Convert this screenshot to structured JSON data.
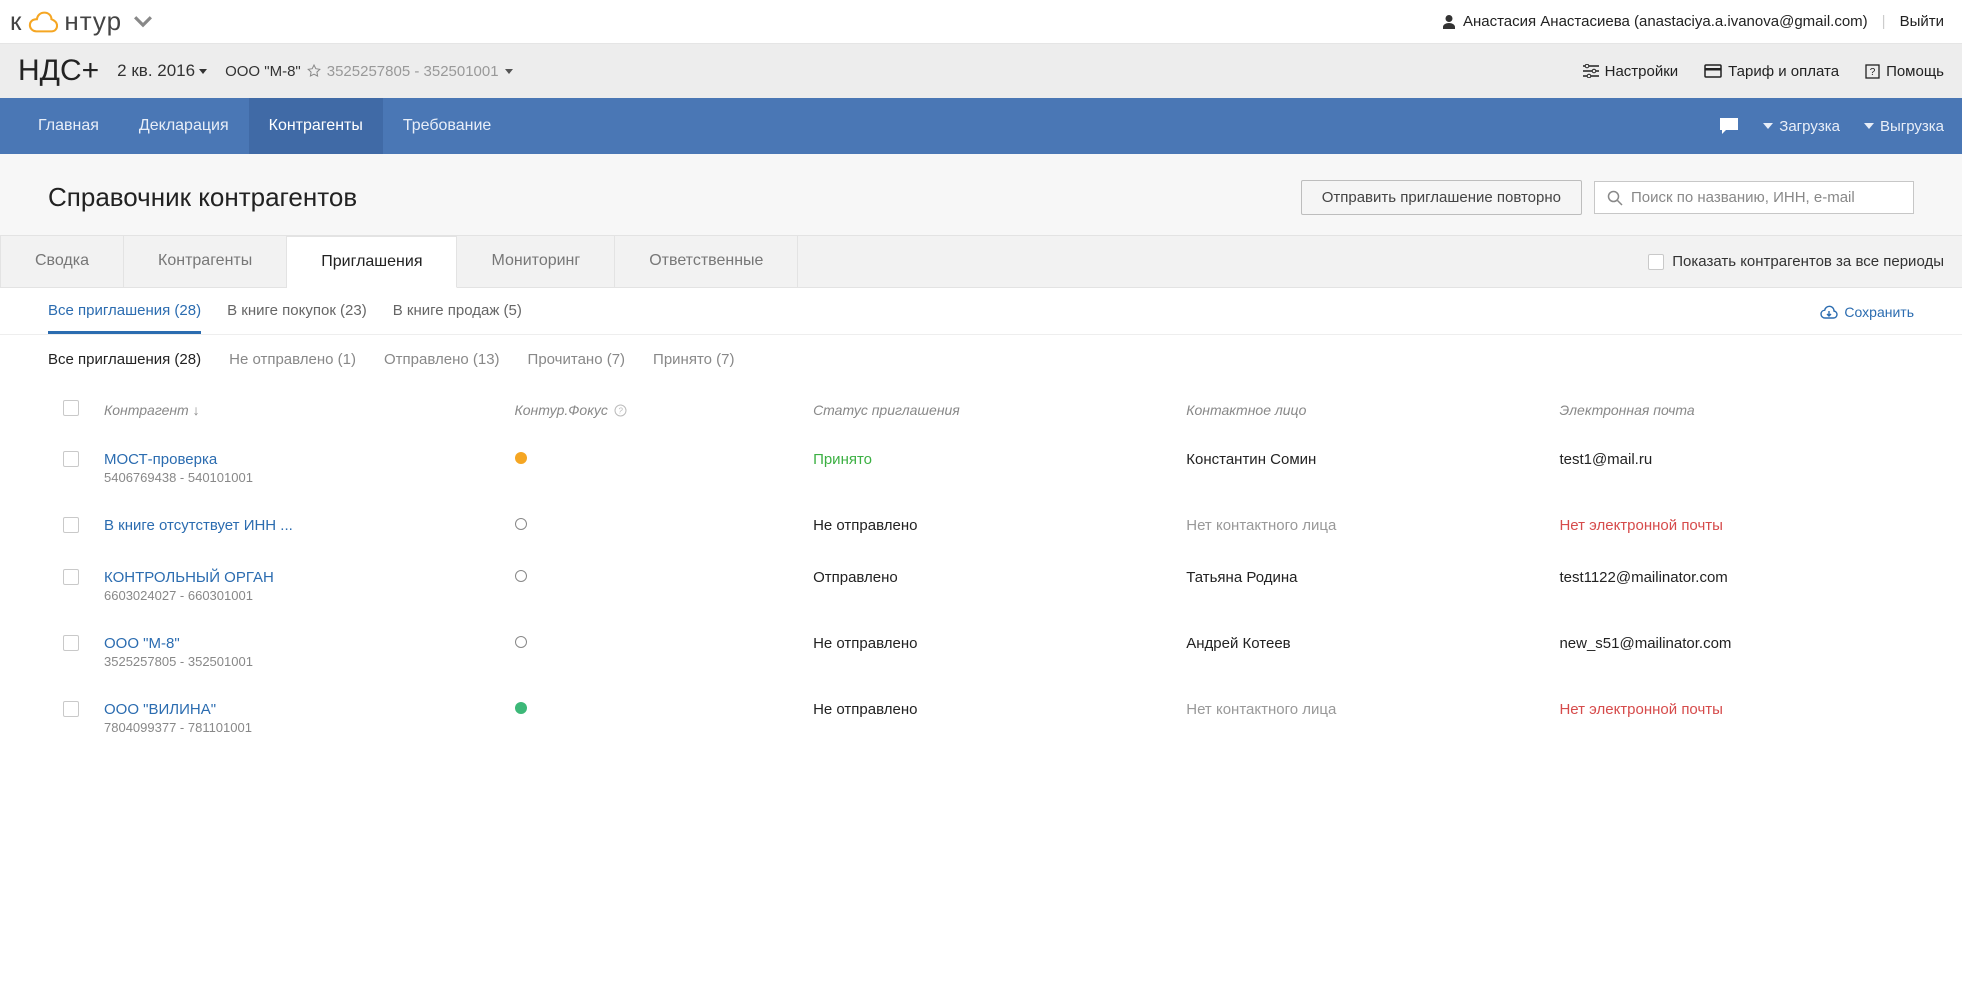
{
  "topbar": {
    "logo_before": "к",
    "logo_after": "нтур",
    "user_name": "Анастасия Анастасиева (anastaciya.a.ivanova@gmail.com)",
    "logout": "Выйти"
  },
  "secondbar": {
    "app": "НДС+",
    "period": "2 кв. 2016",
    "org_name": "ООО \"М-8\"",
    "org_ids": "3525257805 - 352501001",
    "settings": "Настройки",
    "tariff": "Тариф и оплата",
    "help": "Помощь"
  },
  "nav": {
    "items": [
      "Главная",
      "Декларация",
      "Контрагенты",
      "Требование"
    ],
    "download": "Загрузка",
    "upload": "Выгрузка"
  },
  "page": {
    "title": "Справочник контрагентов",
    "resend_btn": "Отправить приглашение повторно",
    "search_placeholder": "Поиск по названию, ИНН, e-mail"
  },
  "tabs": {
    "items": [
      "Сводка",
      "Контрагенты",
      "Приглашения",
      "Мониторинг",
      "Ответственные"
    ],
    "show_all_label": "Показать контрагентов за все периоды"
  },
  "subfilters1": {
    "items": [
      "Все приглашения (28)",
      "В книге покупок (23)",
      "В книге продаж (5)"
    ],
    "save": "Сохранить"
  },
  "subfilters2": {
    "items": [
      "Все приглашения (28)",
      "Не отправлено (1)",
      "Отправлено (13)",
      "Прочитано (7)",
      "Принято (7)"
    ]
  },
  "table": {
    "headers": {
      "contragent": "Контрагент ↓",
      "focus": "Контур.Фокус",
      "status": "Статус приглашения",
      "contact": "Контактное лицо",
      "email": "Электронная почта"
    },
    "rows": [
      {
        "name": "МОСТ-проверка",
        "ids": "5406769438 - 540101001",
        "focus": "orange",
        "status": "Принято",
        "status_class": "status-ok",
        "contact": "Константин Сомин",
        "contact_class": "",
        "email": "test1@mail.ru",
        "email_class": ""
      },
      {
        "name": "В книге отсутствует ИНН ...",
        "ids": "",
        "focus": "empty",
        "status": "Не отправлено",
        "status_class": "",
        "contact": "Нет контактного лица",
        "contact_class": "muted",
        "email": "Нет электронной почты",
        "email_class": "red"
      },
      {
        "name": "КОНТРОЛЬНЫЙ ОРГАН",
        "ids": "6603024027 - 660301001",
        "focus": "empty",
        "status": "Отправлено",
        "status_class": "",
        "contact": "Татьяна Родина",
        "contact_class": "",
        "email": "test1122@mailinator.com",
        "email_class": ""
      },
      {
        "name": "ООО \"М-8\"",
        "ids": "3525257805 - 352501001",
        "focus": "empty",
        "status": "Не отправлено",
        "status_class": "",
        "contact": "Андрей Котеев",
        "contact_class": "",
        "email": "new_s51@mailinator.com",
        "email_class": ""
      },
      {
        "name": "ООО \"ВИЛИНА\"",
        "ids": "7804099377 - 781101001",
        "focus": "green",
        "status": "Не отправлено",
        "status_class": "",
        "contact": "Нет контактного лица",
        "contact_class": "muted",
        "email": "Нет электронной почты",
        "email_class": "red"
      }
    ]
  }
}
